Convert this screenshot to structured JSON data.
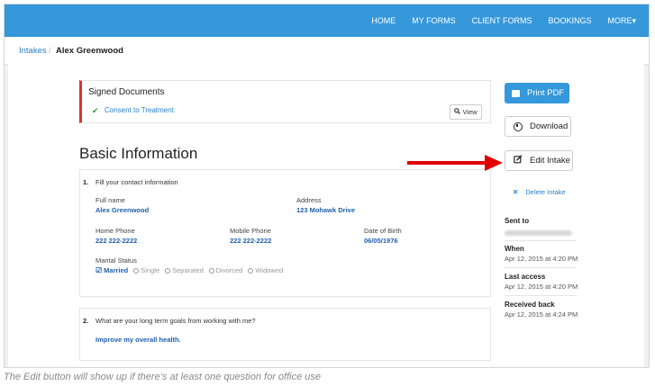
{
  "nav": {
    "items": [
      "HOME",
      "MY FORMS",
      "CLIENT FORMS",
      "BOOKINGS",
      "MORE▾"
    ]
  },
  "breadcrumb": {
    "parent": "Intakes",
    "separator": "/",
    "current": "Alex Greenwood"
  },
  "signed_documents": {
    "title": "Signed Documents",
    "link": "Consent to Treatment",
    "view_label": "View"
  },
  "section_title": "Basic Information",
  "question1": {
    "number": "1.",
    "text": "Fill your contact information",
    "full_name_label": "Full name",
    "full_name": "Alex Greenwood",
    "address_label": "Address",
    "address": "123 Mohawk Drive",
    "home_phone_label": "Home Phone",
    "home_phone": "222 222-2222",
    "mobile_phone_label": "Mobile Phone",
    "mobile_phone": "222 222-2222",
    "dob_label": "Date of Birth",
    "dob": "06/05/1976",
    "marital_label": "Marital Status",
    "marital_options": [
      "Married",
      "Single",
      "Separated",
      "Divorced",
      "Widowed"
    ],
    "marital_selected": "Married"
  },
  "question2": {
    "number": "2.",
    "text": "What are your long term goals from working with me?",
    "answer": "Improve my overall health."
  },
  "sidebar": {
    "print_label": "Print PDF",
    "download_label": "Download",
    "edit_label": "Edit Intake",
    "delete_label": "Delete Intake",
    "sent_to_label": "Sent to",
    "when_label": "When",
    "when_value": "Apr 12, 2015 at 4:20 PM",
    "last_access_label": "Last access",
    "last_access_value": "Apr 12, 2015 at 4:20 PM",
    "received_label": "Received back",
    "received_value": "Apr 12, 2015 at 4:24 PM"
  },
  "caption": "The Edit button will show up if there’s at least one question for office use",
  "colors": {
    "navbar": "#3498db",
    "accent_red": "#e03131",
    "link": "#2a7fc8",
    "value": "#1f5fae"
  },
  "icons": [
    "check-icon",
    "search-icon",
    "print-icon",
    "download-icon",
    "edit-icon",
    "close-icon",
    "arrow-right-icon"
  ]
}
